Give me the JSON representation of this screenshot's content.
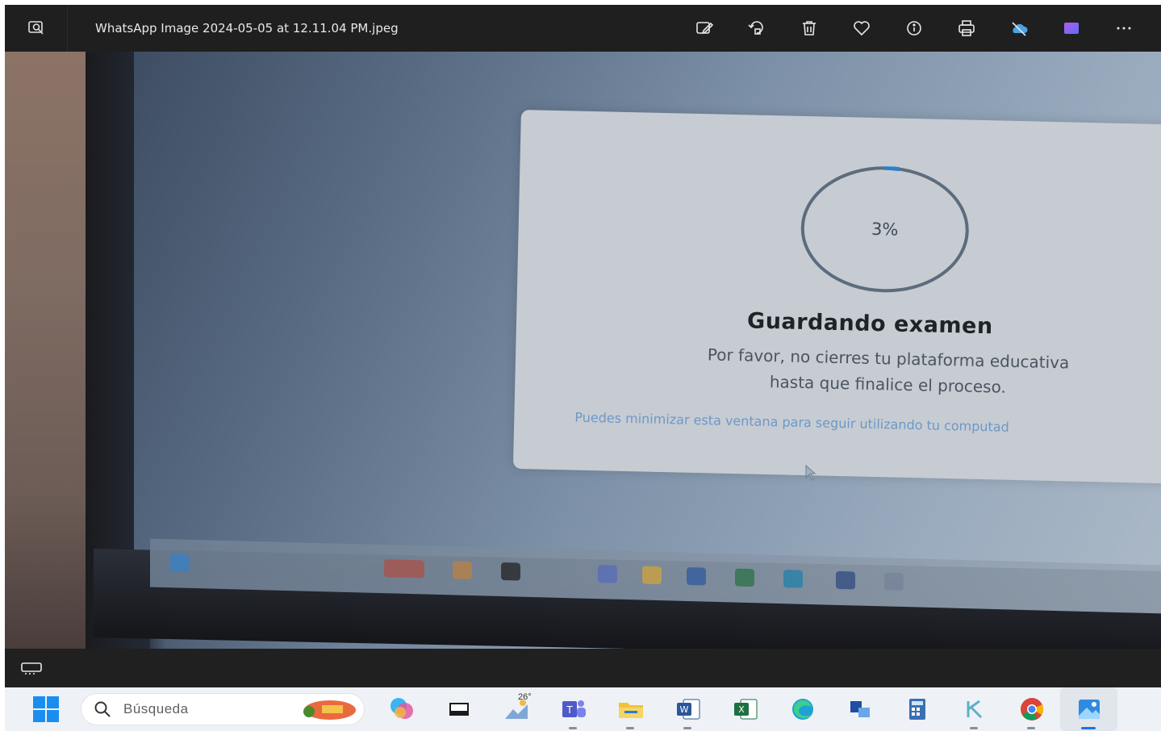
{
  "window": {
    "title": "WhatsApp Image 2024-05-05 at 12.11.04 PM.jpeg"
  },
  "toolbar": {
    "left_icon": "photo-search-icon",
    "actions": [
      {
        "name": "edit-image-icon"
      },
      {
        "name": "rotate-icon"
      },
      {
        "name": "delete-icon"
      },
      {
        "name": "favorite-heart-icon"
      },
      {
        "name": "info-icon"
      },
      {
        "name": "print-icon"
      },
      {
        "name": "onedrive-icon"
      },
      {
        "name": "clipchamp-icon"
      },
      {
        "name": "more-options-icon"
      }
    ]
  },
  "photo": {
    "dialog": {
      "progress_percent": 3,
      "progress_label": "3%",
      "title": "Guardando examen",
      "message_line1": "Por favor, no cierres tu plataforma educativa",
      "message_line2": "hasta que finalice el proceso.",
      "link_text": "Puedes minimizar esta ventana para seguir utilizando tu computad"
    }
  },
  "filmstrip": {
    "toggle_icon": "filmstrip-toggle-icon"
  },
  "taskbar": {
    "search_placeholder": "Búsqueda",
    "weather_temp": "26°",
    "colors": {
      "accent": "#1a73e8",
      "background": "#eef1f6"
    },
    "apps": [
      {
        "name": "copilot-icon"
      },
      {
        "name": "task-view-icon"
      },
      {
        "name": "weather-icon"
      },
      {
        "name": "teams-icon"
      },
      {
        "name": "file-explorer-icon"
      },
      {
        "name": "word-icon"
      },
      {
        "name": "excel-icon"
      },
      {
        "name": "edge-icon"
      },
      {
        "name": "remote-desktop-icon"
      },
      {
        "name": "calculator-icon"
      },
      {
        "name": "app-k-icon"
      },
      {
        "name": "chrome-icon"
      },
      {
        "name": "photos-icon"
      }
    ]
  }
}
